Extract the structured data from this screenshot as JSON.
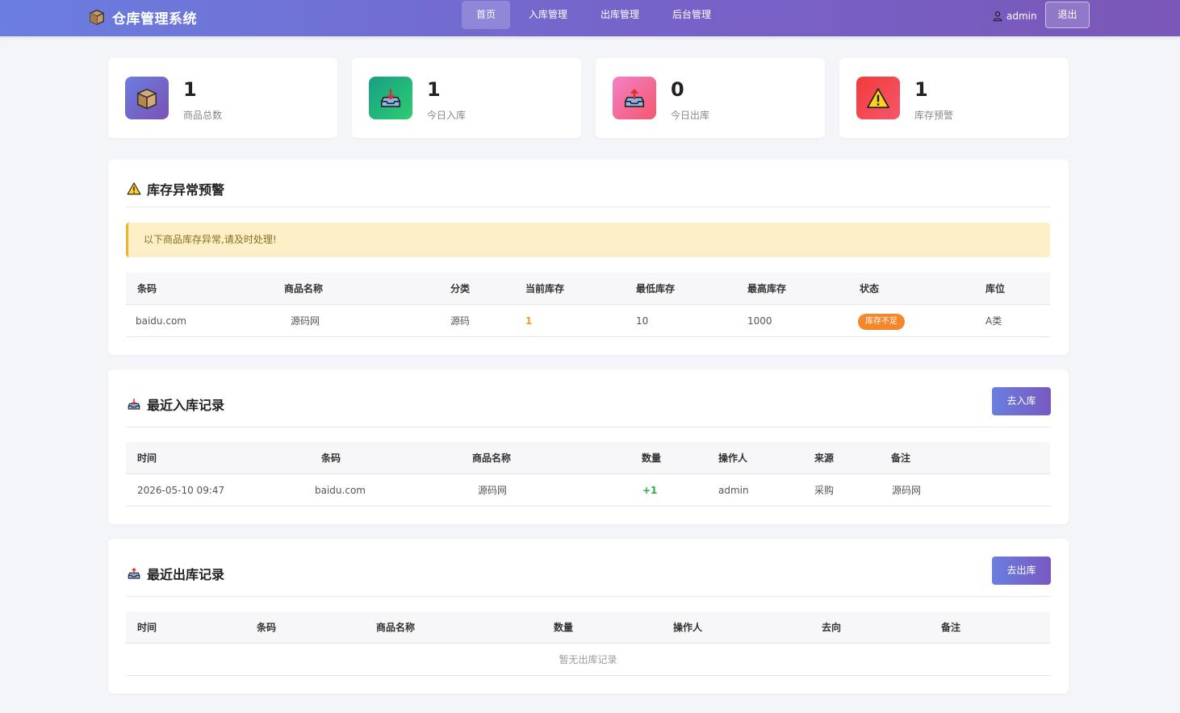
{
  "colors": {
    "accent": "#7468d0",
    "warning": "#f6862a",
    "success": "#2eaa47"
  },
  "nav": {
    "brand": "仓库管理系统",
    "brand_icon": "box-icon",
    "items": [
      {
        "label": "首页",
        "active": true
      },
      {
        "label": "入库管理"
      },
      {
        "label": "出库管理"
      },
      {
        "label": "后台管理"
      }
    ],
    "user": "admin",
    "logout": "退出"
  },
  "stats": [
    {
      "value": "1",
      "label": "商品总数",
      "icon": "box-icon"
    },
    {
      "value": "1",
      "label": "今日入库",
      "icon": "inbound-tray-icon"
    },
    {
      "value": "0",
      "label": "今日出库",
      "icon": "outbound-tray-icon"
    },
    {
      "value": "1",
      "label": "库存预警",
      "icon": "warning-icon"
    }
  ],
  "alert_panel": {
    "title": "库存异常预警",
    "message": "以下商品库存异常,请及时处理!",
    "columns": [
      "条码",
      "商品名称",
      "分类",
      "当前库存",
      "最低库存",
      "最高库存",
      "状态",
      "库位"
    ],
    "rows": [
      {
        "barcode": "baidu.com",
        "name": "源码网",
        "category": "源码",
        "current": "1",
        "min": "10",
        "max": "1000",
        "status": "库存不足",
        "location": "A类"
      }
    ]
  },
  "inbound_panel": {
    "title": "最近入库记录",
    "button": "去入库",
    "columns": [
      "时间",
      "条码",
      "商品名称",
      "数量",
      "操作人",
      "来源",
      "备注"
    ],
    "rows": [
      {
        "time": "2026-05-10 09:47",
        "barcode": "baidu.com",
        "name": "源码网",
        "qty": "+1",
        "operator": "admin",
        "source": "采购",
        "note": "源码网"
      }
    ]
  },
  "outbound_panel": {
    "title": "最近出库记录",
    "button": "去出库",
    "columns": [
      "时间",
      "条码",
      "商品名称",
      "数量",
      "操作人",
      "去向",
      "备注"
    ],
    "empty": "暂无出库记录"
  }
}
